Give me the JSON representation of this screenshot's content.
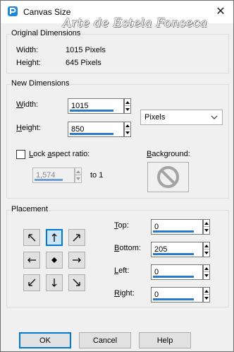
{
  "window": {
    "title": "Canvas Size",
    "watermark": "Arte de Estela Fonseca",
    "close_glyph": "✕"
  },
  "original": {
    "group_title": "Original Dimensions",
    "width_label": "Width:",
    "width_value": "1015 Pixels",
    "height_label": "Height:",
    "height_value": "645 Pixels"
  },
  "new_dims": {
    "group_title": "New Dimensions",
    "width_label": "Width:",
    "width_value": "1015",
    "height_label": "Height:",
    "height_value": "850",
    "units": "Pixels",
    "lock_label": "Lock aspect ratio:",
    "lock_checked": false,
    "ratio_value": "1,574",
    "ratio_suffix": "to 1",
    "background_label": "Background:",
    "background_icon": "no-symbol-icon"
  },
  "placement": {
    "group_title": "Placement",
    "selected_anchor": "top-center",
    "top_label": "Top:",
    "top_value": "0",
    "bottom_label": "Bottom:",
    "bottom_value": "205",
    "left_label": "Left:",
    "left_value": "0",
    "right_label": "Right:",
    "right_value": "0"
  },
  "buttons": {
    "ok": "OK",
    "cancel": "Cancel",
    "help": "Help"
  },
  "colors": {
    "accent": "#0078d7",
    "spin_bar": "#2b79c9"
  }
}
